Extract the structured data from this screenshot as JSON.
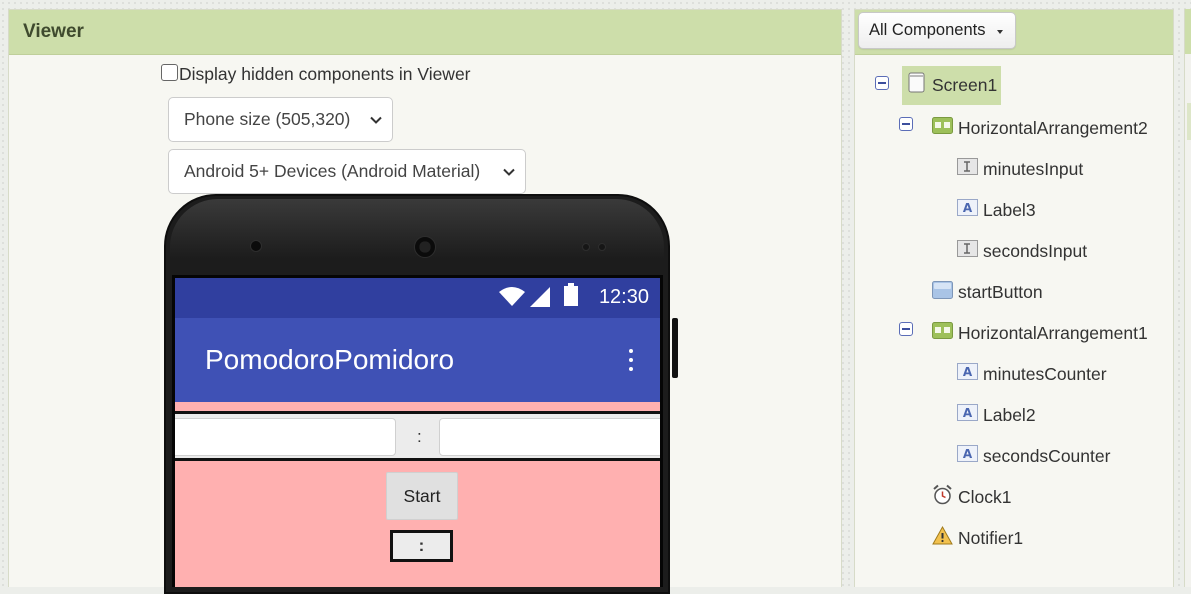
{
  "viewer": {
    "title": "Viewer",
    "hidden_checkbox_label": "Display hidden components in Viewer",
    "phone_size": "Phone size (505,320)",
    "theme": "Android 5+ Devices (Android Material)"
  },
  "phone": {
    "time": "12:30",
    "app_title": "PomodoroPomidoro",
    "separator": ":",
    "start_label": "Start",
    "counter_separator": ":",
    "colors": {
      "status_bar": "#303f9f",
      "app_bar": "#3f51b5",
      "screen_bg": "#ffb0b0"
    }
  },
  "components": {
    "filter": "All Components",
    "tree": [
      {
        "name": "Screen1",
        "icon": "screen-icon",
        "level": 0,
        "selected": true,
        "collapsible": true
      },
      {
        "name": "HorizontalArrangement2",
        "icon": "horizontal-arrangement-icon",
        "level": 1,
        "collapsible": true
      },
      {
        "name": "minutesInput",
        "icon": "textbox-icon",
        "level": 2
      },
      {
        "name": "Label3",
        "icon": "label-icon",
        "level": 2
      },
      {
        "name": "secondsInput",
        "icon": "textbox-icon",
        "level": 2
      },
      {
        "name": "startButton",
        "icon": "button-icon",
        "level": 1
      },
      {
        "name": "HorizontalArrangement1",
        "icon": "horizontal-arrangement-icon",
        "level": 1,
        "collapsible": true
      },
      {
        "name": "minutesCounter",
        "icon": "label-icon",
        "level": 2
      },
      {
        "name": "Label2",
        "icon": "label-icon",
        "level": 2
      },
      {
        "name": "secondsCounter",
        "icon": "label-icon",
        "level": 2
      },
      {
        "name": "Clock1",
        "icon": "clock-icon",
        "level": 1
      },
      {
        "name": "Notifier1",
        "icon": "notifier-icon",
        "level": 1
      }
    ],
    "selection_color": "#cddeaa"
  }
}
